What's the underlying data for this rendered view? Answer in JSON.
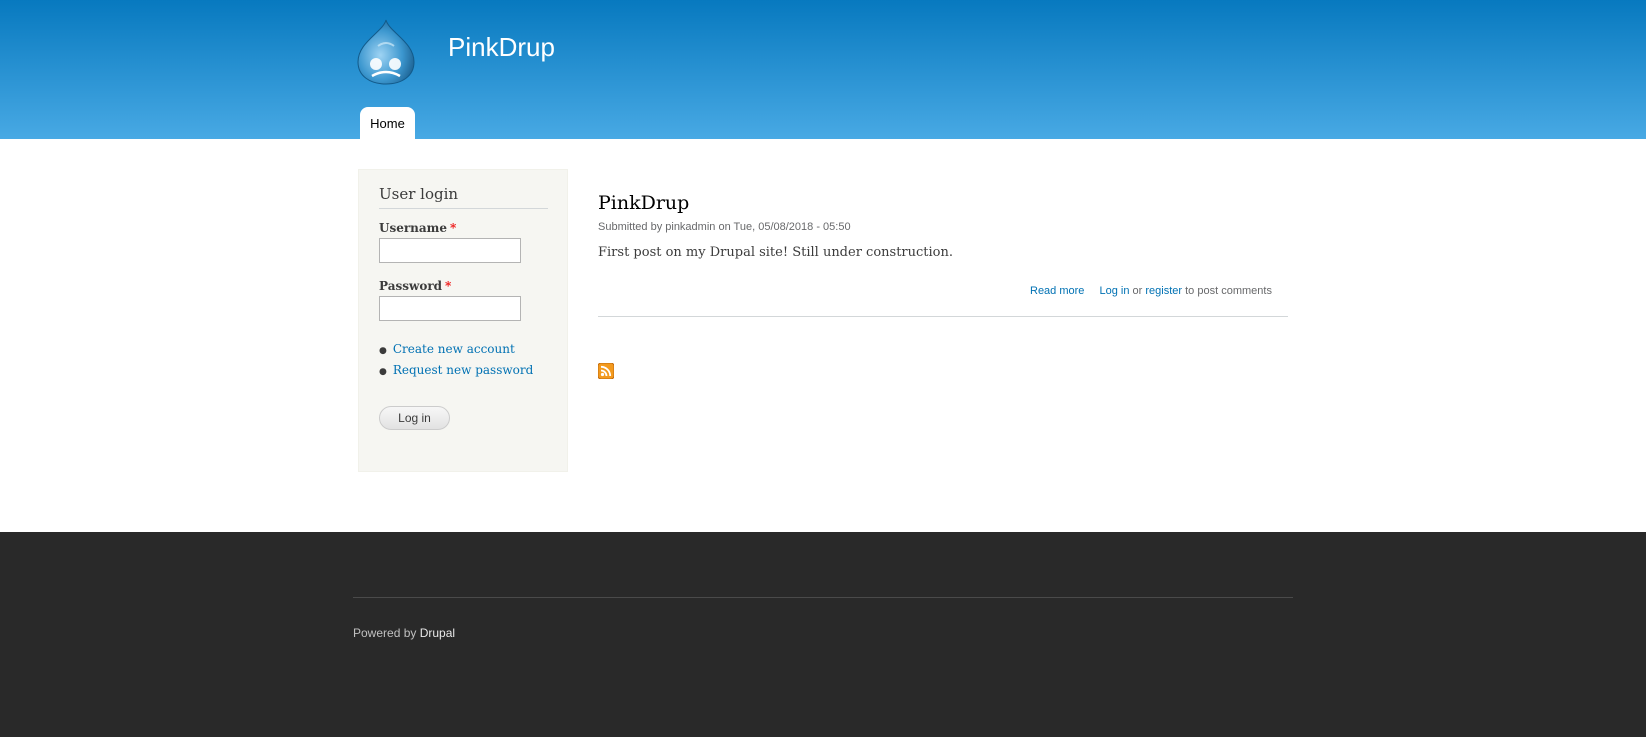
{
  "header": {
    "site_name": "PinkDrup",
    "tabs": [
      {
        "label": "Home"
      }
    ]
  },
  "sidebar": {
    "block_title": "User login",
    "username_label": "Username",
    "password_label": "Password",
    "required_marker": "*",
    "username_value": "",
    "password_value": "",
    "links": [
      {
        "label": "Create new account"
      },
      {
        "label": "Request new password"
      }
    ],
    "login_button_label": "Log in"
  },
  "node": {
    "title": "PinkDrup",
    "meta": "Submitted by pinkadmin on Tue, 05/08/2018 - 05:50",
    "body": "First post on my Drupal site! Still under construction.",
    "read_more": "Read more",
    "login_link": "Log in",
    "or_text": "or",
    "register_link": "register",
    "comments_suffix": "to post comments"
  },
  "feed": {
    "icon": "rss-feed-icon",
    "color": "#f39a1e"
  },
  "footer": {
    "powered_prefix": "Powered by",
    "powered_link": "Drupal"
  },
  "colors": {
    "header_top": "#0779bf",
    "header_bottom": "#48a9e4",
    "link": "#0071b3",
    "footer_bg": "#292929",
    "sidebar_bg": "#f6f6f2"
  }
}
